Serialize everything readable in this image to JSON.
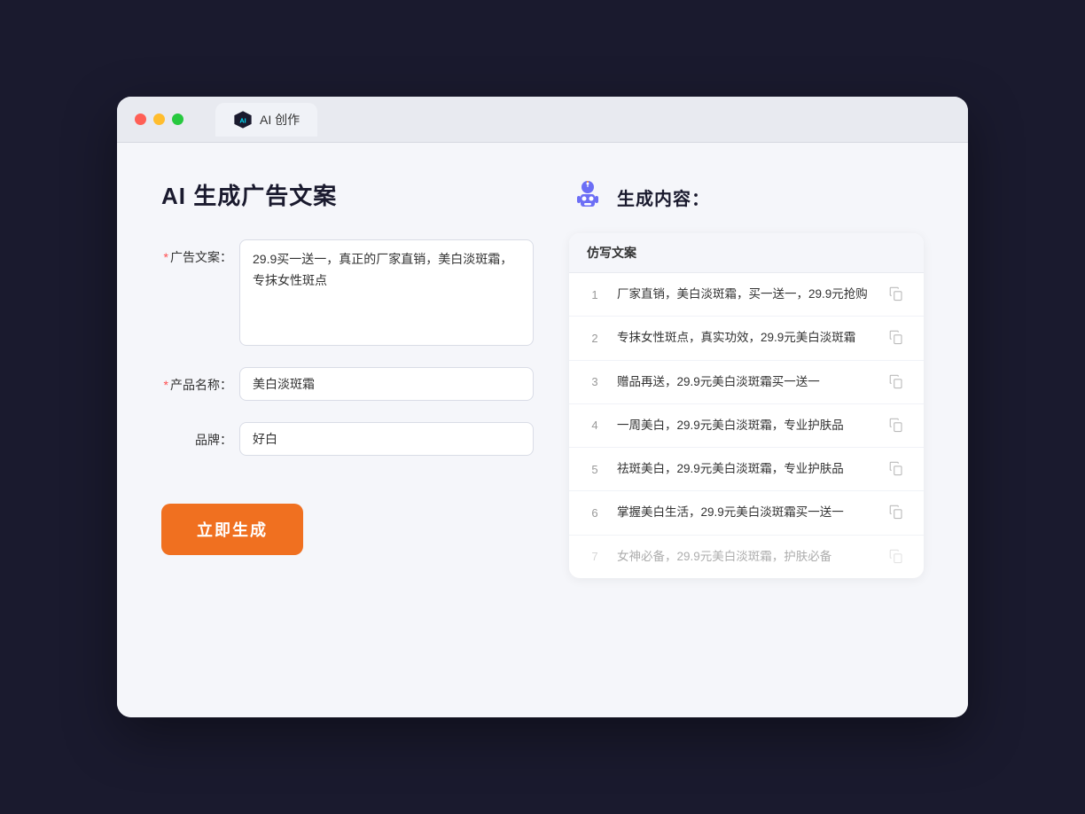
{
  "browser": {
    "tab_title": "AI 创作",
    "traffic_lights": [
      "red",
      "yellow",
      "green"
    ]
  },
  "left_panel": {
    "page_title": "AI 生成广告文案",
    "form": {
      "ad_text_label": "广告文案：",
      "ad_text_required": "*",
      "ad_text_value": "29.9买一送一，真正的厂家直销，美白淡斑霜，专抹女性斑点",
      "product_name_label": "产品名称：",
      "product_name_required": "*",
      "product_name_value": "美白淡斑霜",
      "brand_label": "品牌：",
      "brand_value": "好白"
    },
    "generate_button": "立即生成"
  },
  "right_panel": {
    "title": "生成内容：",
    "table_header": "仿写文案",
    "results": [
      {
        "id": 1,
        "text": "厂家直销，美白淡斑霜，买一送一，29.9元抢购"
      },
      {
        "id": 2,
        "text": "专抹女性斑点，真实功效，29.9元美白淡斑霜"
      },
      {
        "id": 3,
        "text": "赠品再送，29.9元美白淡斑霜买一送一"
      },
      {
        "id": 4,
        "text": "一周美白，29.9元美白淡斑霜，专业护肤品"
      },
      {
        "id": 5,
        "text": "祛斑美白，29.9元美白淡斑霜，专业护肤品"
      },
      {
        "id": 6,
        "text": "掌握美白生活，29.9元美白淡斑霜买一送一"
      },
      {
        "id": 7,
        "text": "女神必备，29.9元美白淡斑霜，护肤必备",
        "faded": true
      }
    ]
  }
}
